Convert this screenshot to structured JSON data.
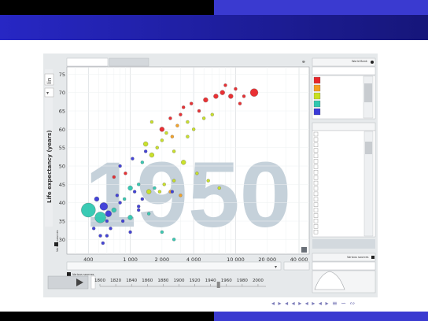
{
  "slide": {
    "nav_symbols": "◂ ▸ ◂ ◂ ▸ ◂ ▸ ◂ ▸ ≡ ∽ ∾"
  },
  "app": {
    "tabs": [
      "",
      ""
    ],
    "year_watermark": "1950",
    "y_axis": {
      "label": "Life expectancy (years)",
      "scale_button": "lin",
      "ticks": [
        30,
        35,
        40,
        45,
        50,
        55,
        60,
        65,
        70,
        75
      ]
    },
    "x_axis": {
      "ticks": [
        "400",
        "1 000",
        "2 000",
        "4 000",
        "10 000",
        "20 000",
        "40 000"
      ]
    },
    "various_sources": "Various sources",
    "timeline": {
      "years": [
        "1800",
        "1820",
        "1840",
        "1860",
        "1880",
        "1900",
        "1920",
        "1940",
        "1960",
        "1980",
        "2000"
      ],
      "current": 1950
    },
    "side_panel": {
      "color_title": "World Bank",
      "legend_colors": [
        "#e8262a",
        "#f5a020",
        "#c8e020",
        "#30c8b0",
        "#3a3ad8"
      ],
      "size_title": "Various sources"
    }
  },
  "chart_data": {
    "type": "scatter",
    "xlabel": "",
    "ylabel": "Life expectancy (years)",
    "x_scale": "log",
    "xlim": [
      250,
      50000
    ],
    "ylim": [
      26,
      77
    ],
    "year": 1950,
    "points": [
      [
        400,
        38,
        "#30c8b0",
        9
      ],
      [
        520,
        36,
        "#30c8b0",
        7
      ],
      [
        560,
        39,
        "#3a3ad8",
        5
      ],
      [
        480,
        41,
        "#3a3ad8",
        3
      ],
      [
        620,
        37,
        "#3a3ad8",
        4
      ],
      [
        700,
        38,
        "#30c8b0",
        3
      ],
      [
        450,
        33,
        "#3a3ad8",
        2
      ],
      [
        520,
        31,
        "#3a3ad8",
        2
      ],
      [
        600,
        35,
        "#3a3ad8",
        2
      ],
      [
        750,
        42,
        "#3a3ad8",
        2
      ],
      [
        880,
        41,
        "#30c8b0",
        2
      ],
      [
        1000,
        44,
        "#30c8b0",
        3
      ],
      [
        1100,
        43,
        "#3a3ad8",
        2
      ],
      [
        1200,
        45,
        "#30c8b0",
        2
      ],
      [
        1300,
        41,
        "#3a3ad8",
        2
      ],
      [
        1500,
        43,
        "#c8e020",
        3
      ],
      [
        1700,
        44,
        "#30c8b0",
        2
      ],
      [
        1900,
        43,
        "#c8e020",
        2
      ],
      [
        2100,
        45,
        "#c8e020",
        2
      ],
      [
        2400,
        43,
        "#f5a020",
        2
      ],
      [
        2600,
        46,
        "#c8e020",
        2
      ],
      [
        3000,
        42,
        "#f5a020",
        2
      ],
      [
        700,
        47,
        "#e8262a",
        2
      ],
      [
        900,
        48,
        "#e8262a",
        2
      ],
      [
        800,
        50,
        "#3a3ad8",
        2
      ],
      [
        1050,
        52,
        "#3a3ad8",
        2
      ],
      [
        1300,
        51,
        "#30c8b0",
        2
      ],
      [
        1600,
        53,
        "#c8e020",
        3
      ],
      [
        1800,
        55,
        "#c8e020",
        2
      ],
      [
        1400,
        56,
        "#c8e020",
        3
      ],
      [
        2000,
        57,
        "#c8e020",
        2
      ],
      [
        2200,
        59,
        "#c8e020",
        2
      ],
      [
        2500,
        58,
        "#f5a020",
        2
      ],
      [
        1600,
        62,
        "#c8e020",
        2
      ],
      [
        2000,
        60,
        "#e8262a",
        3
      ],
      [
        2400,
        63,
        "#e8262a",
        2
      ],
      [
        2800,
        61,
        "#f5a020",
        2
      ],
      [
        3000,
        64,
        "#e8262a",
        2
      ],
      [
        3500,
        62,
        "#c8e020",
        2
      ],
      [
        4000,
        60,
        "#c8e020",
        2
      ],
      [
        3200,
        66,
        "#e8262a",
        2
      ],
      [
        3800,
        67,
        "#e8262a",
        2
      ],
      [
        4500,
        65,
        "#e8262a",
        2
      ],
      [
        5200,
        68,
        "#e8262a",
        3
      ],
      [
        6500,
        69,
        "#e8262a",
        3
      ],
      [
        7500,
        70,
        "#e8262a",
        3
      ],
      [
        9000,
        69,
        "#e8262a",
        3
      ],
      [
        8000,
        72,
        "#e8262a",
        2
      ],
      [
        10000,
        71,
        "#e8262a",
        2
      ],
      [
        12000,
        69,
        "#e8262a",
        2
      ],
      [
        15000,
        70,
        "#e8262a",
        5
      ],
      [
        11000,
        67,
        "#e8262a",
        2
      ],
      [
        6000,
        64,
        "#c8e020",
        2
      ],
      [
        5000,
        63,
        "#c8e020",
        2
      ],
      [
        3500,
        58,
        "#c8e020",
        2
      ],
      [
        2600,
        54,
        "#c8e020",
        2
      ],
      [
        3200,
        51,
        "#c8e020",
        3
      ],
      [
        4300,
        48,
        "#c8e020",
        2
      ],
      [
        5500,
        46,
        "#c8e020",
        2
      ],
      [
        7000,
        44,
        "#c8e020",
        2
      ],
      [
        1200,
        38,
        "#3a3ad8",
        2
      ],
      [
        1500,
        37,
        "#30c8b0",
        2
      ],
      [
        1000,
        36,
        "#30c8b0",
        3
      ],
      [
        850,
        35,
        "#3a3ad8",
        2
      ],
      [
        650,
        33,
        "#3a3ad8",
        2
      ],
      [
        550,
        29,
        "#3a3ad8",
        2
      ],
      [
        600,
        31,
        "#3a3ad8",
        2
      ],
      [
        1000,
        32,
        "#3a3ad8",
        2
      ],
      [
        2000,
        32,
        "#30c8b0",
        2
      ],
      [
        2600,
        30,
        "#30c8b0",
        2
      ],
      [
        1200,
        39,
        "#3a3ad8",
        2
      ],
      [
        800,
        40,
        "#3a3ad8",
        2
      ],
      [
        1400,
        54,
        "#3a3ad8",
        2
      ],
      [
        2500,
        43,
        "#3a3ad8",
        2
      ]
    ]
  }
}
